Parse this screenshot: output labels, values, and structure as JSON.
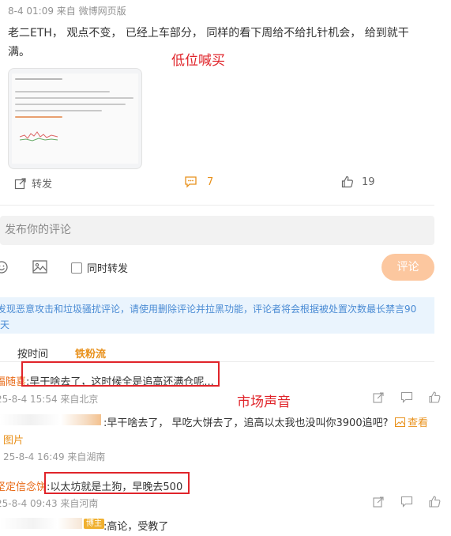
{
  "post": {
    "meta": "8-4 01:09  来自 微博网页版",
    "text_line1": "老二ETH， 观点不变， 已经上车部分， 同样的看下周给不给扎针机会， 给到就干",
    "text_line2": "满。",
    "annotation": "低位喊买"
  },
  "actions": {
    "repost": "转发",
    "comments": "7",
    "likes": "19"
  },
  "composer": {
    "placeholder": "发布你的评论",
    "also_repost": "同时转发",
    "submit": "评论"
  },
  "notice": {
    "line1": "发现恶意攻击和垃圾骚扰评论，请使用删除评论并拉黑功能，评论者将会根据被处置次数最长禁言90",
    "line2": "天"
  },
  "tabs": {
    "by_time": "按时间",
    "fans": "铁粉流"
  },
  "annotation2": "市场声音",
  "comments": [
    {
      "user": "福随喜",
      "text": ":早干啥去了，这时候全是追高还满仓呢...",
      "meta": "25-8-4 15:54  来自北京"
    },
    {
      "user": "",
      "text": ":早干啥去了， 早吃大饼去了，追高以太我也没叫你3900追吧?",
      "view": "查看",
      "view2": "图片",
      "meta": "25-8-4 16:49  来自湖南"
    },
    {
      "user": "坚定信念饼",
      "text": ":以太坊就是土狗，早晚去500",
      "meta": "25-8-4 09:43  来自河南"
    },
    {
      "user": "",
      "badge": "博主",
      "text": ":高论，受教了"
    }
  ]
}
